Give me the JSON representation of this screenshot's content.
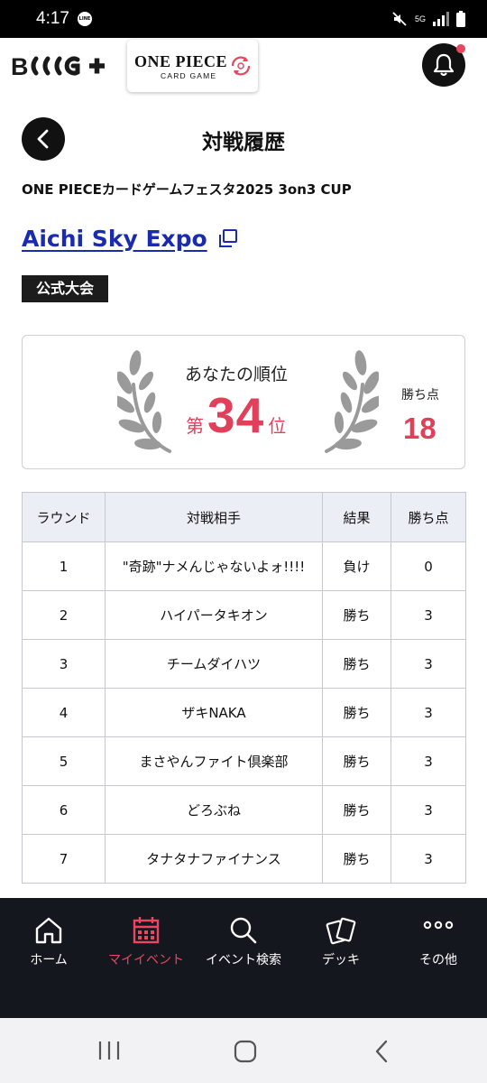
{
  "status_bar": {
    "time": "4:17",
    "line_badge": "LINE",
    "network": "5G"
  },
  "header": {
    "brand": "B",
    "op_logo_title": "ONE PIECE",
    "op_logo_subtitle": "CARD GAME"
  },
  "page": {
    "title": "対戦履歴",
    "event_name": "ONE PIECEカードゲームフェスタ2025 3on3 CUP",
    "venue": "Aichi Sky Expo",
    "tag": "公式大会"
  },
  "rank": {
    "label": "あなたの順位",
    "prefix": "第",
    "value": "34",
    "suffix": "位",
    "points_label": "勝ち点",
    "points_value": "18"
  },
  "table": {
    "headers": [
      "ラウンド",
      "対戦相手",
      "結果",
      "勝ち点"
    ],
    "rows": [
      {
        "round": "1",
        "opponent": "\"奇跡\"ナメんじゃないよォ!!!!",
        "result": "負け",
        "points": "0"
      },
      {
        "round": "2",
        "opponent": "ハイパータキオン",
        "result": "勝ち",
        "points": "3"
      },
      {
        "round": "3",
        "opponent": "チームダイハツ",
        "result": "勝ち",
        "points": "3"
      },
      {
        "round": "4",
        "opponent": "ザキNAKA",
        "result": "勝ち",
        "points": "3"
      },
      {
        "round": "5",
        "opponent": "まさやんファイト倶楽部",
        "result": "勝ち",
        "points": "3"
      },
      {
        "round": "6",
        "opponent": "どろぶね",
        "result": "勝ち",
        "points": "3"
      },
      {
        "round": "7",
        "opponent": "タナタナファイナンス",
        "result": "勝ち",
        "points": "3"
      }
    ]
  },
  "bottom_nav": [
    {
      "label": "ホーム",
      "icon": "home-icon",
      "active": false
    },
    {
      "label": "マイイベント",
      "icon": "calendar-icon",
      "active": true
    },
    {
      "label": "イベント検索",
      "icon": "search-icon",
      "active": false
    },
    {
      "label": "デッキ",
      "icon": "cards-icon",
      "active": false
    },
    {
      "label": "その他",
      "icon": "more-icon",
      "active": false
    }
  ],
  "colors": {
    "accent": "#e0405a",
    "link": "#1a2bb0",
    "nav_bg": "#15171f",
    "table_header_bg": "#eceef6"
  }
}
